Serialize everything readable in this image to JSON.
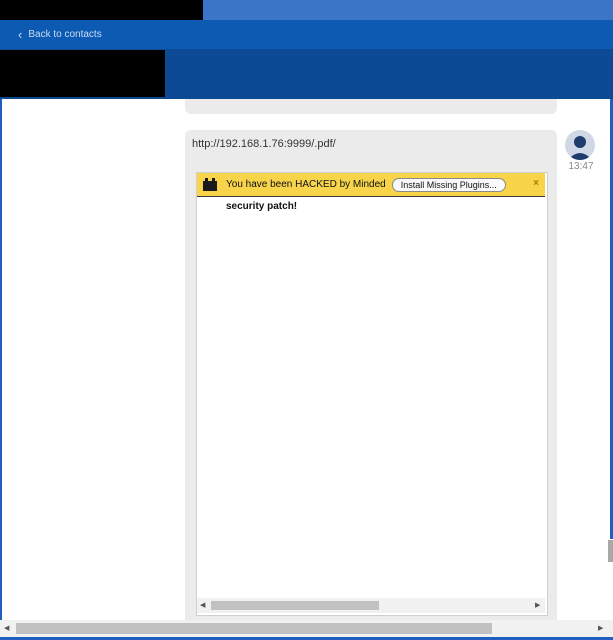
{
  "nav": {
    "back_label": "Back to contacts"
  },
  "message": {
    "url": "http://192.168.1.76:9999/.pdf/",
    "time": "13:47"
  },
  "plugin_bar": {
    "message": "You have been HACKED by Minded",
    "install_label": "Install Missing Plugins...",
    "close_glyph": "×",
    "background": "#f7d44a"
  },
  "embed": {
    "content_text": "security patch!"
  },
  "scrollbar": {
    "left_arrow": "◀",
    "right_arrow": "▶"
  },
  "colors": {
    "accent": "#0d5ab3",
    "header": "#0d4a96",
    "bubble": "#ebebeb"
  }
}
